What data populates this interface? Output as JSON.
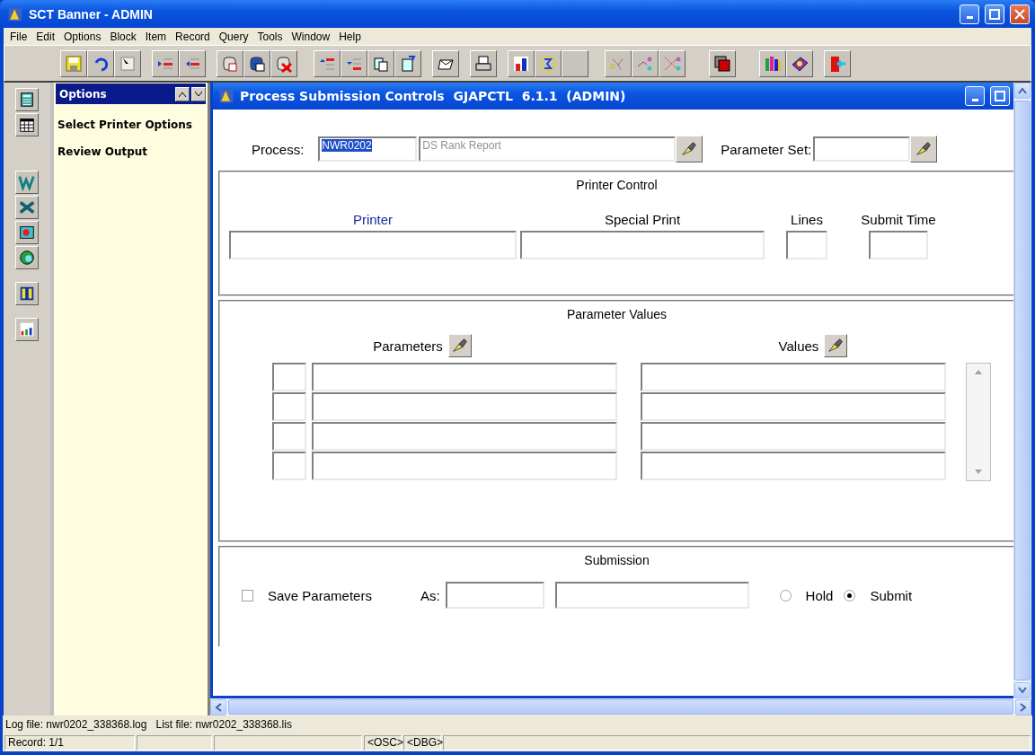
{
  "window": {
    "title": "SCT Banner - ADMIN"
  },
  "menu": [
    "File",
    "Edit",
    "Options",
    "Block",
    "Item",
    "Record",
    "Query",
    "Tools",
    "Window",
    "Help"
  ],
  "options_panel": {
    "title": "Options",
    "items": [
      "Select Printer Options",
      "Review Output"
    ]
  },
  "form": {
    "title": "Process Submission Controls  GJAPCTL  6.1.1  (ADMIN)",
    "process": {
      "label": "Process:",
      "code": "NWR0202",
      "code_selected": true,
      "description": "DS Rank Report"
    },
    "parameter_set": {
      "label": "Parameter Set:"
    },
    "printer_control": {
      "title": "Printer Control",
      "columns": [
        {
          "label": "Printer",
          "highlighted": true
        },
        {
          "label": "Special Print",
          "highlighted": false
        },
        {
          "label": "Lines",
          "highlighted": false
        },
        {
          "label": "Submit Time",
          "highlighted": false
        }
      ]
    },
    "parameter_values": {
      "title": "Parameter Values",
      "parameters_label": "Parameters",
      "values_label": "Values"
    },
    "submission": {
      "title": "Submission",
      "save_label": "Save Parameters",
      "save_checked": false,
      "as_label": "As:",
      "options": [
        {
          "label": "Hold",
          "selected": false
        },
        {
          "label": "Submit",
          "selected": true
        }
      ]
    }
  },
  "status": {
    "log_file": "Log file: nwr0202_338368.log",
    "list_file": "List file: nwr0202_338368.lis",
    "record": "Record: 1/1",
    "osc": "<OSC>",
    "dbg": "<DBG>"
  }
}
